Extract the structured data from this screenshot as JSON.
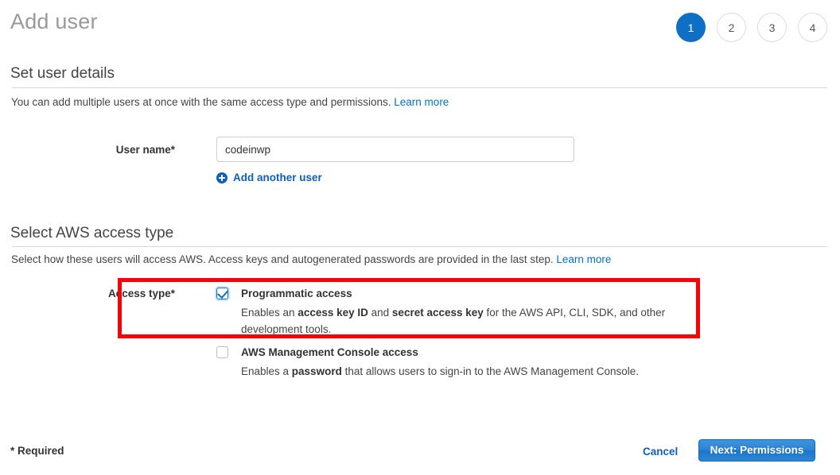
{
  "header": {
    "title": "Add user",
    "steps": [
      {
        "label": "1",
        "active": true
      },
      {
        "label": "2",
        "active": false
      },
      {
        "label": "3",
        "active": false
      },
      {
        "label": "4",
        "active": false
      }
    ],
    "active_step_color": "#0f6fc5"
  },
  "user_details": {
    "heading": "Set user details",
    "description": "You can add multiple users at once with the same access type and permissions.",
    "learn_more": "Learn more",
    "user_name_label": "User name*",
    "user_name_value": "codeinwp",
    "user_name_placeholder": "",
    "add_another_user": "Add another user"
  },
  "access_type": {
    "heading": "Select AWS access type",
    "description": "Select how these users will access AWS. Access keys and autogenerated passwords are provided in the last step.",
    "learn_more": "Learn more",
    "label": "Access type*",
    "options": [
      {
        "title": "Programmatic access",
        "checked": true,
        "desc_part_1": "Enables an ",
        "desc_bold_1": "access key ID",
        "desc_part_2": " and ",
        "desc_bold_2": "secret access key",
        "desc_part_3": " for the AWS API, CLI, SDK, and other development tools."
      },
      {
        "title": "AWS Management Console access",
        "checked": false,
        "desc_part_1": "Enables a ",
        "desc_bold_1": "password",
        "desc_part_2": " that allows users to sign-in to the AWS Management Console.",
        "desc_bold_2": "",
        "desc_part_3": ""
      }
    ],
    "highlight_color": "#fb0007"
  },
  "footer": {
    "required_note": "* Required",
    "cancel_label": "Cancel",
    "next_label": "Next: Permissions"
  }
}
